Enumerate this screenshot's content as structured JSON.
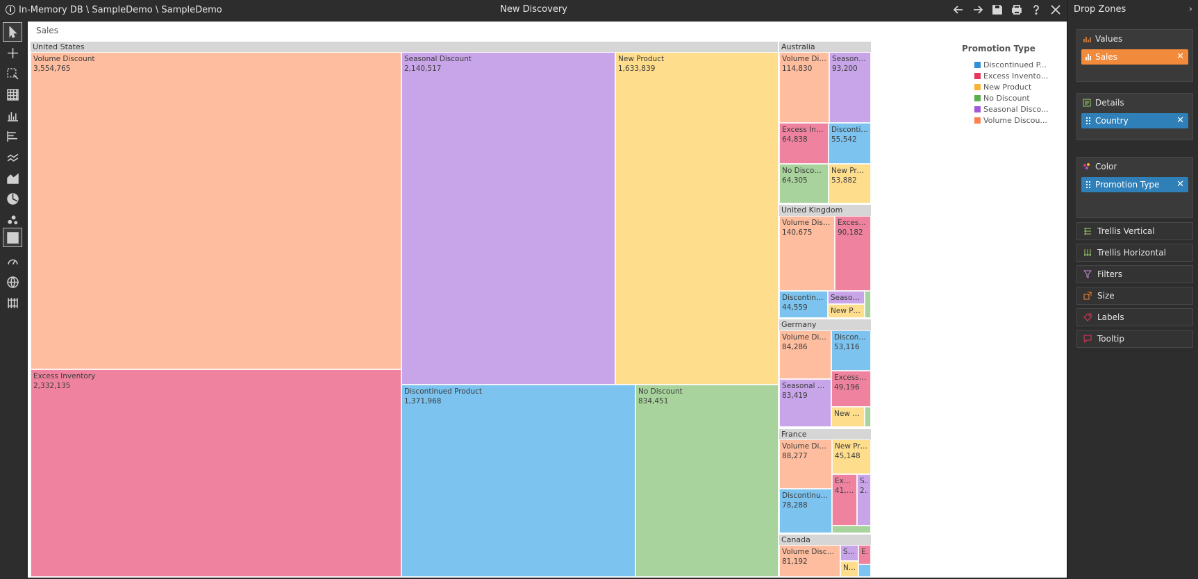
{
  "title_bar": {
    "breadcrumb": "In-Memory DB \\ SampleDemo \\ SampleDemo",
    "title": "New Discovery"
  },
  "canvas": {
    "measure_label": "Sales"
  },
  "colors": {
    "Discontinued Product": "#7cc3ef",
    "Excess Inventory": "#ef839f",
    "New Product": "#fedd8c",
    "No Discount": "#a8d39c",
    "Seasonal Discount": "#c8a5e8",
    "Volume Discount": "#fdbd9e"
  },
  "legend": {
    "title": "Promotion Type",
    "items": [
      {
        "label": "Discontinued P...",
        "color": "#2f8fd8"
      },
      {
        "label": "Excess Inventor...",
        "color": "#e8365a"
      },
      {
        "label": "New Product",
        "color": "#f6b432"
      },
      {
        "label": "No Discount",
        "color": "#5aae4d"
      },
      {
        "label": "Seasonal Disco...",
        "color": "#a259d9"
      },
      {
        "label": "Volume Discou...",
        "color": "#fb7f4f"
      }
    ]
  },
  "chart_data": {
    "type": "treemap",
    "measure": "Sales",
    "groups": [
      {
        "name": "United States",
        "cells": [
          {
            "label": "Volume Discount",
            "value": 3554765,
            "value_text": "3,554,765",
            "type": "Volume Discount"
          },
          {
            "label": "Seasonal Discount",
            "value": 2140517,
            "value_text": "2,140,517",
            "type": "Seasonal Discount"
          },
          {
            "label": "New Product",
            "value": 1633839,
            "value_text": "1,633,839",
            "type": "New Product"
          },
          {
            "label": "Excess Inventory",
            "value": 2332135,
            "value_text": "2,332,135",
            "type": "Excess Inventory"
          },
          {
            "label": "Discontinued Product",
            "value": 1371968,
            "value_text": "1,371,968",
            "type": "Discontinued Product"
          },
          {
            "label": "No Discount",
            "value": 834451,
            "value_text": "834,451",
            "type": "No Discount"
          }
        ]
      },
      {
        "name": "Australia",
        "cells": [
          {
            "label": "Volume Disc...",
            "value": 114830,
            "value_text": "114,830",
            "type": "Volume Discount"
          },
          {
            "label": "Seasonal ...",
            "value": 93200,
            "value_text": "93,200",
            "type": "Seasonal Discount"
          },
          {
            "label": "Excess Invent...",
            "value": 64838,
            "value_text": "64,838",
            "type": "Excess Inventory"
          },
          {
            "label": "Discontinu...",
            "value": 55542,
            "value_text": "55,542",
            "type": "Discontinued Product"
          },
          {
            "label": "No Discount",
            "value": 64305,
            "value_text": "64,305",
            "type": "No Discount"
          },
          {
            "label": "New Prod...",
            "value": 53882,
            "value_text": "53,882",
            "type": "New Product"
          }
        ]
      },
      {
        "name": "United Kingdom",
        "cells": [
          {
            "label": "Volume Discou...",
            "value": 140675,
            "value_text": "140,675",
            "type": "Volume Discount"
          },
          {
            "label": "Excess I...",
            "value": 90182,
            "value_text": "90,182",
            "type": "Excess Inventory"
          },
          {
            "label": "Discontinued...",
            "value": 44559,
            "value_text": "44,559",
            "type": "Discontinued Product"
          },
          {
            "label": "Seasonal...",
            "value": null,
            "value_text": "",
            "type": "Seasonal Discount"
          },
          {
            "label": "New Pro...",
            "value": null,
            "value_text": "",
            "type": "New Product"
          },
          {
            "label": "",
            "value": null,
            "value_text": "",
            "type": "No Discount"
          }
        ]
      },
      {
        "name": "Germany",
        "cells": [
          {
            "label": "Volume Disco...",
            "value": 84286,
            "value_text": "84,286",
            "type": "Volume Discount"
          },
          {
            "label": "Disconti...",
            "value": 53116,
            "value_text": "53,116",
            "type": "Discontinued Product"
          },
          {
            "label": "Seasonal Disc...",
            "value": 83419,
            "value_text": "83,419",
            "type": "Seasonal Discount"
          },
          {
            "label": "Excess Inv...",
            "value": 49196,
            "value_text": "49,196",
            "type": "Excess Inventory"
          },
          {
            "label": "New Pr...",
            "value": null,
            "value_text": "",
            "type": "New Product"
          },
          {
            "label": "",
            "value": null,
            "value_text": "",
            "type": "No Discount"
          }
        ]
      },
      {
        "name": "France",
        "cells": [
          {
            "label": "Volume Disco...",
            "value": 88277,
            "value_text": "88,277",
            "type": "Volume Discount"
          },
          {
            "label": "New Pro...",
            "value": 45148,
            "value_text": "45,148",
            "type": "New Product"
          },
          {
            "label": "Discontinued ...",
            "value": 78288,
            "value_text": "78,288",
            "type": "Discontinued Product"
          },
          {
            "label": "Exce...",
            "value": null,
            "value_text": "41,6...",
            "type": "Excess Inventory"
          },
          {
            "label": "S...",
            "value": null,
            "value_text": "2...",
            "type": "Seasonal Discount"
          },
          {
            "label": "",
            "value": null,
            "value_text": "",
            "type": "No Discount"
          }
        ]
      },
      {
        "name": "Canada",
        "cells": [
          {
            "label": "Volume Discount",
            "value": 81192,
            "value_text": "81,192",
            "type": "Volume Discount"
          },
          {
            "label": "Se...",
            "value": null,
            "value_text": "",
            "type": "Seasonal Discount"
          },
          {
            "label": "E...",
            "value": null,
            "value_text": "",
            "type": "Excess Inventory"
          },
          {
            "label": "N...",
            "value": null,
            "value_text": "",
            "type": "New Product"
          },
          {
            "label": "",
            "value": null,
            "value_text": "",
            "type": "Discontinued Product"
          }
        ]
      }
    ]
  },
  "right_panel": {
    "title": "Drop Zones",
    "zones": [
      {
        "title": "Values",
        "chip": "Sales",
        "chip_color": "orange"
      },
      {
        "title": "Details",
        "chip": "Country",
        "chip_color": "blue"
      },
      {
        "title": "Color",
        "chip": "Promotion Type",
        "chip_color": "blue"
      }
    ],
    "slots": [
      "Trellis Vertical",
      "Trellis Horizontal",
      "Filters",
      "Size",
      "Labels",
      "Tooltip"
    ]
  }
}
